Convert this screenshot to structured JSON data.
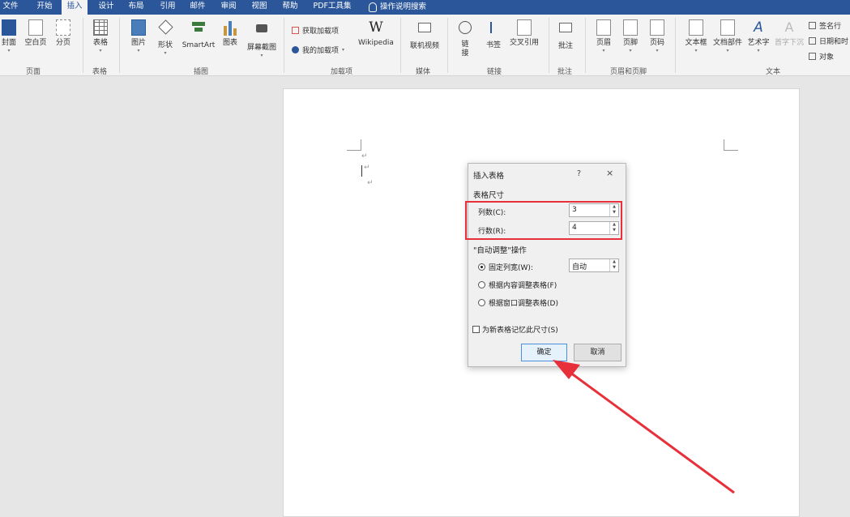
{
  "tabs": [
    "文件",
    "开始",
    "插入",
    "设计",
    "布局",
    "引用",
    "邮件",
    "审阅",
    "视图",
    "帮助",
    "PDF工具集"
  ],
  "active_tab": "插入",
  "tell_me": "操作说明搜索",
  "ribbon": {
    "pages": {
      "cover": "封面",
      "blank": "空白页",
      "break": "分页",
      "group": "页面"
    },
    "tables": {
      "table": "表格",
      "group": "表格"
    },
    "illustrations": {
      "picture": "图片",
      "shape": "形状",
      "smartart": "SmartArt",
      "chart": "图表",
      "screenshot": "屏幕截图",
      "group": "插图"
    },
    "addins": {
      "get": "获取加载项",
      "mine": "我的加载项",
      "wikipedia": "Wikipedia",
      "wiki_glyph": "W",
      "group": "加载项"
    },
    "media": {
      "video": "联机视频",
      "group": "媒体"
    },
    "links": {
      "link_a": "链",
      "link_b": "接",
      "bookmark": "书签",
      "crossref": "交叉引用",
      "group": "链接"
    },
    "comments": {
      "comment": "批注",
      "group": "批注"
    },
    "headerfooter": {
      "header": "页眉",
      "footer": "页脚",
      "pagenum": "页码",
      "group": "页眉和页脚"
    },
    "text": {
      "textbox": "文本框",
      "parts": "文档部件",
      "wordart": "艺术字",
      "dropcap": "首字下沉",
      "signature": "签名行",
      "datetime": "日期和时",
      "object": "对象",
      "group": "文本"
    }
  },
  "dialog": {
    "title": "插入表格",
    "help": "?",
    "close": "×",
    "size_section": "表格尺寸",
    "cols_label": "列数(C):",
    "cols_value": "3",
    "rows_label": "行数(R):",
    "rows_value": "4",
    "autofit_section": "\"自动调整\"操作",
    "fixed_label": "固定列宽(W):",
    "fixed_value": "自动",
    "content_label": "根据内容调整表格(F)",
    "window_label": "根据窗口调整表格(D)",
    "remember_label": "为新表格记忆此尺寸(S)",
    "ok": "确定",
    "cancel": "取消"
  },
  "colors": {
    "accent": "#2b579a",
    "annotation": "#e8303a"
  }
}
